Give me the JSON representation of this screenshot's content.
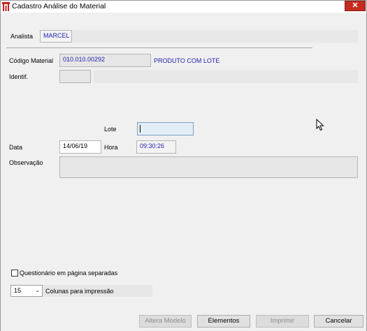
{
  "window": {
    "title": "Cadastro Análise do Material",
    "close_label": "✕"
  },
  "form": {
    "analista_label": "Analista",
    "analista_value": "MARCEL",
    "codigo_label": "Código Material",
    "codigo_value": "010.010.00292",
    "produto_desc": "PRODUTO COM LOTE",
    "identif_label": "Identif.",
    "identif_value": "",
    "lote_label": "Lote",
    "lote_value": "",
    "data_label": "Data",
    "data_value": "14/06/19",
    "hora_label": "Hora",
    "hora_value": "09:30:26",
    "observacao_label": "Observação",
    "observacao_value": ""
  },
  "options": {
    "questionario_label": "Questionário em página separadas",
    "questionario_checked": false,
    "colunas_value": "15",
    "colunas_label": "Colunas para impressão"
  },
  "buttons": {
    "altera_modelo": "Altera Modelo",
    "elementos": "Elementos",
    "imprimir": "Imprimir",
    "cancelar": "Cancelar"
  }
}
